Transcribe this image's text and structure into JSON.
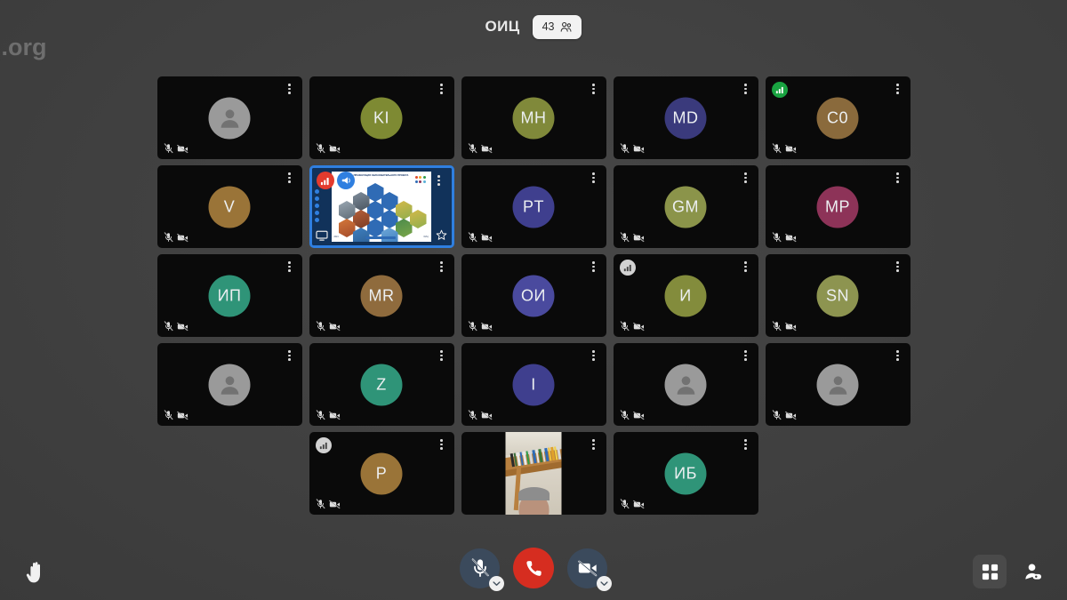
{
  "watermark": "i.org",
  "header": {
    "meeting_title": "ОИЦ",
    "participant_count": "43",
    "participants_icon": "people-group-icon"
  },
  "colors": {
    "accent_blue": "#2f7fe0",
    "hangup_red": "#d62d20",
    "signal_green": "#19a341",
    "signal_grey": "#d2d2d2",
    "signal_red": "#e33b2e",
    "tile_background": "#0a0a0a",
    "stage_background": "#3e3e3e"
  },
  "grid": {
    "rows": [
      [
        {
          "label": "",
          "avatar": "generic",
          "color": "#9a9a9a",
          "mic": "muted",
          "camera": "off",
          "signal": null,
          "type": "avatar"
        },
        {
          "label": "KI",
          "avatar": "initials",
          "color": "#7e8a33",
          "mic": "muted",
          "camera": "off",
          "signal": null,
          "type": "avatar"
        },
        {
          "label": "МН",
          "avatar": "initials",
          "color": "#80893a",
          "mic": "muted",
          "camera": "off",
          "signal": null,
          "type": "avatar"
        },
        {
          "label": "MD",
          "avatar": "initials",
          "color": "#3a3a7c",
          "mic": "muted",
          "camera": "off",
          "signal": null,
          "type": "avatar"
        },
        {
          "label": "C0",
          "avatar": "initials",
          "color": "#8a6a3c",
          "mic": "muted",
          "camera": "off",
          "signal": "green",
          "type": "avatar"
        }
      ],
      [
        {
          "label": "V",
          "avatar": "initials",
          "color": "#9a7438",
          "mic": "muted",
          "camera": "off",
          "signal": null,
          "type": "avatar"
        },
        {
          "label": "",
          "avatar": "screenshare",
          "color": "#11325a",
          "mic": "muted",
          "camera": "off",
          "signal": "red",
          "type": "screenshare"
        },
        {
          "label": "PT",
          "avatar": "initials",
          "color": "#3f3f8e",
          "mic": "muted",
          "camera": "off",
          "signal": null,
          "type": "avatar"
        },
        {
          "label": "GM",
          "avatar": "initials",
          "color": "#8b944a",
          "mic": "muted",
          "camera": "off",
          "signal": null,
          "type": "avatar"
        },
        {
          "label": "MP",
          "avatar": "initials",
          "color": "#8d3358",
          "mic": "muted",
          "camera": "off",
          "signal": null,
          "type": "avatar"
        }
      ],
      [
        {
          "label": "ИП",
          "avatar": "initials",
          "color": "#2f9478",
          "mic": "muted",
          "camera": "off",
          "signal": null,
          "type": "avatar"
        },
        {
          "label": "MR",
          "avatar": "initials",
          "color": "#8f6b3d",
          "mic": "muted",
          "camera": "off",
          "signal": null,
          "type": "avatar"
        },
        {
          "label": "ОИ",
          "avatar": "initials",
          "color": "#4a4a9e",
          "mic": "muted",
          "camera": "off",
          "signal": null,
          "type": "avatar"
        },
        {
          "label": "И",
          "avatar": "initials",
          "color": "#838c3c",
          "mic": "muted",
          "camera": "off",
          "signal": "grey",
          "type": "avatar"
        },
        {
          "label": "SN",
          "avatar": "initials",
          "color": "#8d9450",
          "mic": "muted",
          "camera": "off",
          "signal": null,
          "type": "avatar"
        }
      ],
      [
        {
          "label": "",
          "avatar": "generic",
          "color": "#9a9a9a",
          "mic": "muted",
          "camera": "off",
          "signal": null,
          "type": "avatar"
        },
        {
          "label": "Z",
          "avatar": "initials",
          "color": "#2f9478",
          "mic": "muted",
          "camera": "off",
          "signal": null,
          "type": "avatar"
        },
        {
          "label": "I",
          "avatar": "initials",
          "color": "#3f3f8e",
          "mic": "muted",
          "camera": "off",
          "signal": null,
          "type": "avatar"
        },
        {
          "label": "",
          "avatar": "generic",
          "color": "#9a9a9a",
          "mic": "muted",
          "camera": "off",
          "signal": null,
          "type": "avatar"
        },
        {
          "label": "",
          "avatar": "generic",
          "color": "#9a9a9a",
          "mic": "muted",
          "camera": "off",
          "signal": null,
          "type": "avatar"
        }
      ],
      [
        {
          "label": "P",
          "avatar": "initials",
          "color": "#9a7438",
          "mic": "muted",
          "camera": "off",
          "signal": "grey",
          "type": "avatar"
        },
        {
          "label": "",
          "avatar": "video",
          "color": "#000000",
          "mic": "on",
          "camera": "on",
          "signal": null,
          "type": "video"
        },
        {
          "label": "ИБ",
          "avatar": "initials",
          "color": "#2f9478",
          "mic": "muted",
          "camera": "off",
          "signal": null,
          "type": "avatar"
        }
      ]
    ]
  },
  "screenshare": {
    "red_badge_icon": "signal-bars-icon",
    "blue_badge_icon": "megaphone-icon",
    "monitor_icon": "monitor-icon",
    "star_icon": "star-icon",
    "rail_dots": 5,
    "slide_title": "ПРЕЗЕНТАЦИЯ ОБРАЗОВАТЕЛЬНОГО ПРОЕКТА",
    "slide_footer_left": "2024",
    "slide_footer_right": "ОИЦ"
  },
  "bottom_bar": {
    "raise_hand": {
      "label": "Raise hand",
      "icon": "raised-hand-icon"
    },
    "mic": {
      "label": "Unmute microphone",
      "icon": "microphone-muted-icon",
      "state": "muted"
    },
    "hangup": {
      "label": "Leave call",
      "icon": "phone-hangup-icon"
    },
    "camera": {
      "label": "Start camera",
      "icon": "camera-muted-icon",
      "state": "off"
    },
    "grid_view": {
      "label": "Tile view",
      "icon": "grid-view-icon",
      "state": "active"
    },
    "participants": {
      "label": "Participants",
      "icon": "person-add-icon"
    }
  }
}
